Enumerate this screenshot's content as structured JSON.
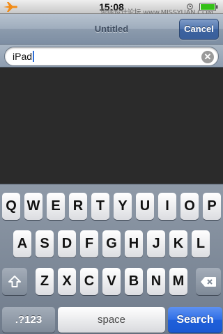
{
  "status_bar": {
    "time": "15:08",
    "watermark": "思缘设计论坛 www.MISSYUAN.COM",
    "icons": [
      "airplane-icon",
      "alarm-icon",
      "battery-icon"
    ],
    "battery_color": "#34c017"
  },
  "nav_bar": {
    "title": "Untitled",
    "cancel_label": "Cancel"
  },
  "search": {
    "value": "iPad",
    "clear_icon": "clear-icon",
    "clear_glyph": "✕"
  },
  "keyboard": {
    "row1": [
      "Q",
      "W",
      "E",
      "R",
      "T",
      "Y",
      "U",
      "I",
      "O",
      "P"
    ],
    "row2": [
      "A",
      "S",
      "D",
      "F",
      "G",
      "H",
      "J",
      "K",
      "L"
    ],
    "row3": [
      "Z",
      "X",
      "C",
      "V",
      "B",
      "N",
      "M"
    ],
    "shift_icon": "shift-icon",
    "delete_icon": "delete-icon",
    "numbers_label": ".?123",
    "space_label": "space",
    "search_label": "Search",
    "accent_color": "#2f6ee6"
  }
}
